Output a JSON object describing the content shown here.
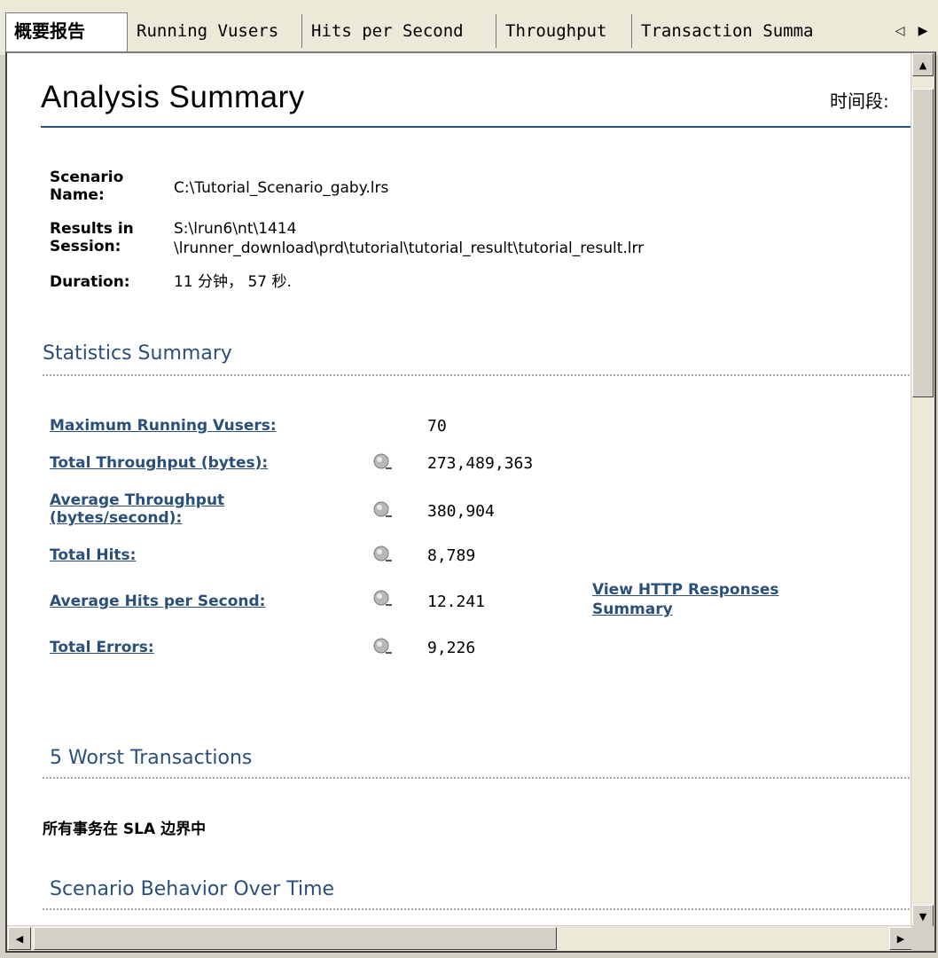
{
  "tabs": [
    {
      "label": "概要报告",
      "active": true
    },
    {
      "label": "Running Vusers"
    },
    {
      "label": "Hits per Second"
    },
    {
      "label": "Throughput"
    },
    {
      "label": "Transaction Summa"
    }
  ],
  "report": {
    "title": "Analysis Summary",
    "time_label": "时间段:",
    "meta": [
      {
        "key": "Scenario Name:",
        "value": "C:\\Tutorial_Scenario_gaby.lrs"
      },
      {
        "key": "Results in Session:",
        "value_line1": "S:\\lrun6\\nt\\1414",
        "value_line2": "\\lrunner_download\\prd\\tutorial\\tutorial_result\\tutorial_result.lrr"
      },
      {
        "key": "Duration:",
        "value": "11 分钟， 57 秒."
      }
    ],
    "statistics_title": "Statistics Summary",
    "stats": [
      {
        "label": "Maximum Running Vusers:",
        "value": "70",
        "icon": false
      },
      {
        "label": "Total Throughput (bytes):",
        "value": "273,489,363",
        "icon": true
      },
      {
        "label": "Average Throughput (bytes/second):",
        "value": "380,904",
        "icon": true
      },
      {
        "label": "Total Hits:",
        "value": "8,789",
        "icon": true
      },
      {
        "label": "Average Hits per Second:",
        "value": "12.241",
        "icon": true
      },
      {
        "label": "Total Errors:",
        "value": "9,226",
        "icon": true
      }
    ],
    "http_link": "View HTTP Responses Summary",
    "worst_title": "5 Worst Transactions",
    "sla_text": "所有事务在 SLA 边界中",
    "behavior_title": "Scenario Behavior Over Time"
  }
}
